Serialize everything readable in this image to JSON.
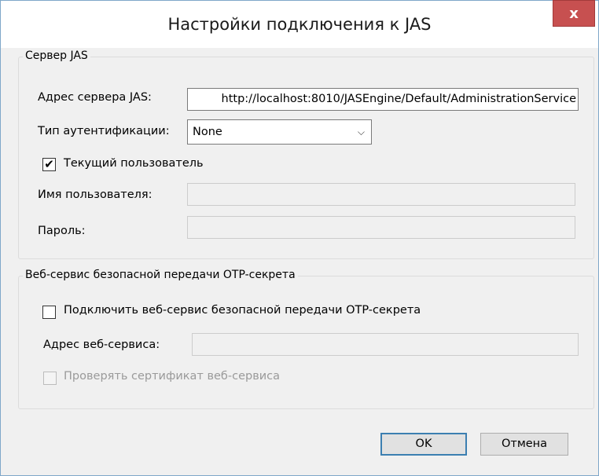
{
  "window": {
    "title": "Настройки подключения к JAS",
    "close_label": "x"
  },
  "jas_group": {
    "legend": "Сервер JAS",
    "server_address_label": "Адрес сервера JAS:",
    "server_address_value": "http://localhost:8010/JASEngine/Default/AdministrationService",
    "auth_type_label": "Тип аутентификации:",
    "auth_type_value": "None",
    "current_user_label": "Текущий пользователь",
    "current_user_checked": "✔",
    "username_label": "Имя пользователя:",
    "username_value": "",
    "password_label": "Пароль:",
    "password_value": ""
  },
  "otp_group": {
    "legend": "Веб-сервис безопасной передачи OTP-секрета",
    "enable_label": "Подключить веб-сервис безопасной передачи OTP-секрета",
    "service_address_label": "Адрес веб-сервиса:",
    "service_address_value": "",
    "verify_cert_label": "Проверять сертификат веб-сервиса"
  },
  "buttons": {
    "ok": "OK",
    "cancel": "Отмена"
  },
  "icons": {
    "dropdown": "chevron-down-icon",
    "checkmark": "checkmark-icon"
  }
}
